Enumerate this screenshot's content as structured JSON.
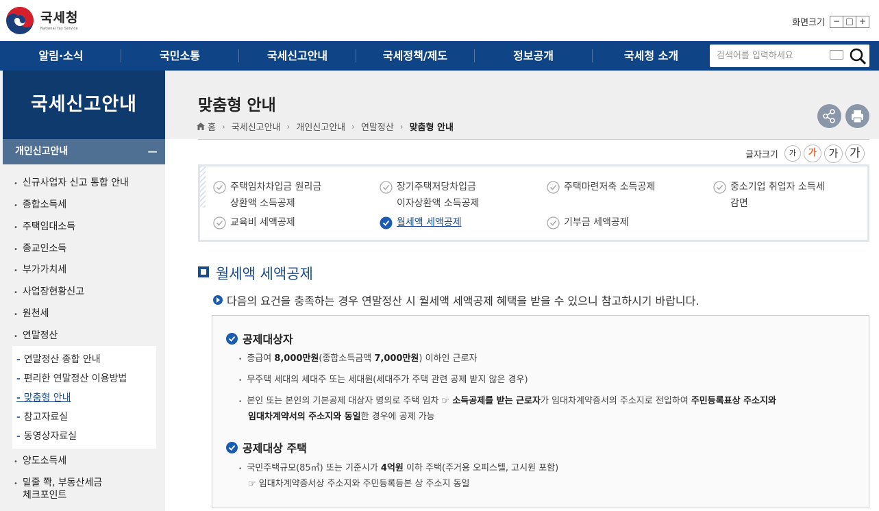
{
  "header": {
    "logo_main": "국세청",
    "logo_sub": "National Tax Service",
    "zoom_label": "화면크기",
    "zoom_buttons": [
      "−",
      "□",
      "+"
    ]
  },
  "gnb": {
    "items": [
      "알림·소식",
      "국민소통",
      "국세신고안내",
      "국세정책/제도",
      "정보공개",
      "국세청 소개"
    ],
    "search_placeholder": "검색어를 입력하세요"
  },
  "sidebar": {
    "title": "국세신고안내",
    "subtitle": "개인신고안내",
    "collapse_symbol": "−",
    "items": [
      "신규사업자 신고 통합 안내",
      "종합소득세",
      "주택임대소득",
      "종교인소득",
      "부가가치세",
      "사업장현황신고",
      "원천세",
      "연말정산"
    ],
    "subitems": [
      "연말정산 종합 안내",
      "편리한 연말정산 이용방법",
      "맞춤형 안내",
      "참고자료실",
      "동영상자료실"
    ],
    "items_after": [
      "양도소득세",
      "밑줄 쫙, 부동산세금",
      "체크포인트"
    ]
  },
  "page": {
    "title": "맞춤형 안내",
    "breadcrumb": [
      "홈",
      "국세신고안내",
      "개인신고안내",
      "연말정산",
      "맞춤형 안내"
    ],
    "font_size_label": "글자크기",
    "font_size_buttons": [
      "가",
      "가",
      "가",
      "가"
    ]
  },
  "tabs": [
    {
      "line1": "주택임차차입금 원리금",
      "line2": "상환액 소득공제"
    },
    {
      "line1": "장기주택저당차입금",
      "line2": "이자상환액 소득공제"
    },
    {
      "line1": "주택마련저축 소득공제",
      "line2": ""
    },
    {
      "line1": "중소기업 취업자 소득세",
      "line2": "감면"
    },
    {
      "line1": "교육비 세액공제",
      "line2": ""
    },
    {
      "line1": "월세액 세액공제",
      "line2": ""
    },
    {
      "line1": "기부금 세액공제",
      "line2": ""
    }
  ],
  "section": {
    "title": "월세액 세액공제",
    "intro": "다음의 요건을 충족하는 경우 연말정산 시 월세액 세액공제 혜택을 받을 수 있으니 참고하시기 바랍니다.",
    "h1": "공제대상자",
    "l1a": "총급여 ",
    "l1b": "8,000만원",
    "l1c": "(종합소득금액 ",
    "l1d": "7,000만원",
    "l1e": ") 이하인 근로자",
    "l2": "무주택 세대의 세대주 또는 세대원(세대주가 주택 관련 공제 받지 않은 경우)",
    "l3a": "본인 또는 본인의 기본공제 대상자 명의로 주택 임차 ☞ ",
    "l3b": "소득공제를 받는 근로자",
    "l3c": "가 임대차계약증서의 주소지로 전입하여 ",
    "l3d": "주민등록표상 주소지와",
    "l4a": "임대차계약서의 주소지와 동일",
    "l4b": "한 경우에 공제 가능",
    "h2": "공제대상 주택",
    "l5a": "국민주택규모(85㎡) 또는 기준시가 ",
    "l5b": "4억원",
    "l5c": " 이하 주택(주거용 오피스텔, 고시원 포함)",
    "l6": "☞ 임대차계약증서상 주소지와 주민등록등본 상 주소지 동일"
  },
  "colors": {
    "gnb": "#0f4486",
    "sidebar_title": "#0e3a6e",
    "sidebar_sub": "#4f6f93",
    "accent": "#1a4c8a",
    "font_active": "#e8621d"
  }
}
